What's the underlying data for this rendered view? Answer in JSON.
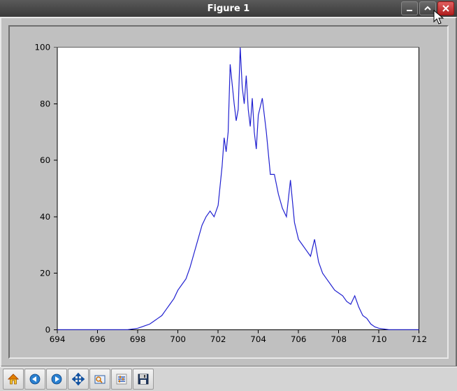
{
  "window": {
    "title": "Figure 1"
  },
  "chart_data": {
    "type": "line",
    "xlabel": "",
    "ylabel": "",
    "title": "",
    "xlim": [
      694,
      712
    ],
    "ylim": [
      0,
      100
    ],
    "xticks": [
      694,
      696,
      698,
      700,
      702,
      704,
      706,
      708,
      710,
      712
    ],
    "yticks": [
      0,
      20,
      40,
      60,
      80,
      100
    ],
    "x": [
      694.0,
      694.5,
      695.0,
      695.5,
      696.0,
      696.5,
      697.0,
      697.5,
      698.0,
      698.2,
      698.4,
      698.6,
      698.8,
      699.0,
      699.2,
      699.4,
      699.6,
      699.8,
      700.0,
      700.2,
      700.4,
      700.6,
      700.8,
      701.0,
      701.2,
      701.4,
      701.6,
      701.8,
      702.0,
      702.2,
      702.3,
      702.4,
      702.5,
      702.6,
      702.8,
      702.9,
      703.0,
      703.1,
      703.2,
      703.3,
      703.4,
      703.5,
      703.6,
      703.7,
      703.8,
      703.9,
      704.0,
      704.2,
      704.4,
      704.6,
      704.8,
      705.0,
      705.2,
      705.4,
      705.6,
      705.8,
      706.0,
      706.2,
      706.4,
      706.6,
      706.8,
      707.0,
      707.2,
      707.4,
      707.6,
      707.8,
      708.0,
      708.2,
      708.4,
      708.6,
      708.8,
      709.0,
      709.2,
      709.4,
      709.6,
      709.8,
      710.0,
      710.5,
      711.0,
      712.0
    ],
    "y": [
      0,
      0,
      0,
      0,
      0,
      0,
      0,
      0,
      0.5,
      1,
      1.5,
      2,
      3,
      4,
      5,
      7,
      9,
      11,
      14,
      16,
      18,
      22,
      27,
      32,
      37,
      40,
      42,
      40,
      44,
      58,
      68,
      63,
      70,
      94,
      80,
      74,
      78,
      100,
      86,
      80,
      90,
      78,
      72,
      82,
      70,
      64,
      76,
      82,
      70,
      55,
      55,
      48,
      43,
      40,
      53,
      38,
      32,
      30,
      28,
      26,
      32,
      24,
      20,
      18,
      16,
      14,
      13,
      12,
      10,
      9,
      12,
      8,
      5,
      4,
      2,
      1,
      0.5,
      0,
      0,
      0
    ]
  },
  "toolbar": {
    "buttons": [
      "home",
      "back",
      "forward",
      "pan",
      "zoom",
      "subplots",
      "save"
    ]
  }
}
